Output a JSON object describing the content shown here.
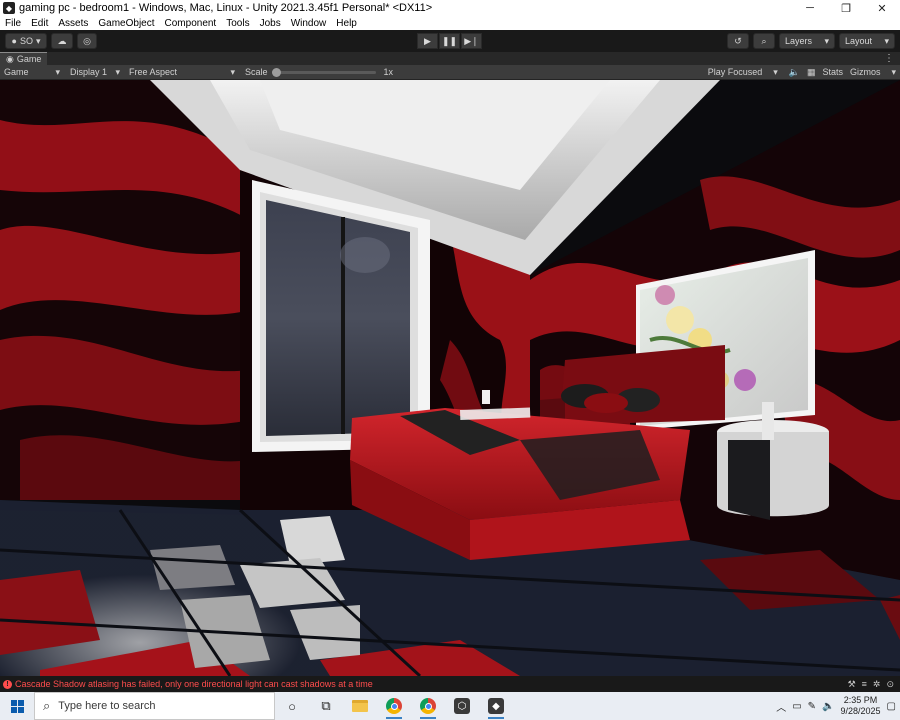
{
  "window": {
    "title": "gaming pc - bedroom1 - Windows, Mac, Linux - Unity 2021.3.45f1 Personal* <DX11>",
    "minimize": "─",
    "maximize": "❐",
    "close": "✕"
  },
  "menu": [
    "File",
    "Edit",
    "Assets",
    "GameObject",
    "Component",
    "Tools",
    "Jobs",
    "Window",
    "Help"
  ],
  "toolbar": {
    "account": "SO",
    "layers": "Layers",
    "layout": "Layout"
  },
  "game_tab": {
    "label": "Game"
  },
  "game_controls": {
    "mode": "Game",
    "display": "Display 1",
    "aspect": "Free Aspect",
    "scale_label": "Scale",
    "scale_value": "1x",
    "scale_fraction": 0,
    "play_mode": "Play Focused",
    "stats": "Stats",
    "gizmos": "Gizmos"
  },
  "status": {
    "message": "Cascade Shadow atlasing has failed, only one directional light can cast shadows at a time"
  },
  "taskbar": {
    "search_placeholder": "Type here to search",
    "time": "2:35 PM",
    "date": "9/28/2025"
  },
  "colors": {
    "unity_dark": "#191919",
    "panel": "#3c3c3c",
    "error": "#ff4d4d",
    "wall_red": "#b3141b",
    "bed_red": "#c2161e"
  }
}
